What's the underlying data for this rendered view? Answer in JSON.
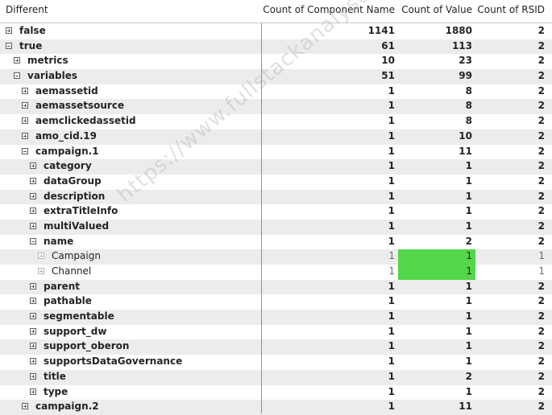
{
  "headers": {
    "label": "Different",
    "col1": "Count of Component Name",
    "col2": "Count of Value",
    "col3": "Count of RSID"
  },
  "watermark": "https://www.fullstackanalyst.io",
  "colors": {
    "highlight": "#54d64a",
    "separator": "#5b9bd5",
    "band": "#ececec"
  },
  "rows": [
    {
      "label": "false",
      "level": 0,
      "toggle": "plus",
      "c1": "1141",
      "c2": "1880",
      "c3": "2"
    },
    {
      "label": "true",
      "level": 0,
      "toggle": "minus",
      "c1": "61",
      "c2": "113",
      "c3": "2"
    },
    {
      "label": "metrics",
      "level": 1,
      "toggle": "plus",
      "c1": "10",
      "c2": "23",
      "c3": "2"
    },
    {
      "label": "variables",
      "level": 1,
      "toggle": "minus",
      "c1": "51",
      "c2": "99",
      "c3": "2"
    },
    {
      "label": "aemassetid",
      "level": 2,
      "toggle": "plus",
      "c1": "1",
      "c2": "8",
      "c3": "2"
    },
    {
      "label": "aemassetsource",
      "level": 2,
      "toggle": "plus",
      "c1": "1",
      "c2": "8",
      "c3": "2"
    },
    {
      "label": "aemclickedassetid",
      "level": 2,
      "toggle": "plus",
      "c1": "1",
      "c2": "8",
      "c3": "2"
    },
    {
      "label": "amo_cid.19",
      "level": 2,
      "toggle": "plus",
      "c1": "1",
      "c2": "10",
      "c3": "2"
    },
    {
      "label": "campaign.1",
      "level": 2,
      "toggle": "minus",
      "c1": "1",
      "c2": "11",
      "c3": "2"
    },
    {
      "label": "category",
      "level": 3,
      "toggle": "plus",
      "c1": "1",
      "c2": "1",
      "c3": "2"
    },
    {
      "label": "dataGroup",
      "level": 3,
      "toggle": "plus",
      "c1": "1",
      "c2": "1",
      "c3": "2"
    },
    {
      "label": "description",
      "level": 3,
      "toggle": "plus",
      "c1": "1",
      "c2": "1",
      "c3": "2"
    },
    {
      "label": "extraTitleInfo",
      "level": 3,
      "toggle": "plus",
      "c1": "1",
      "c2": "1",
      "c3": "2"
    },
    {
      "label": "multiValued",
      "level": 3,
      "toggle": "plus",
      "c1": "1",
      "c2": "1",
      "c3": "2"
    },
    {
      "label": "name",
      "level": 3,
      "toggle": "minus",
      "c1": "1",
      "c2": "2",
      "c3": "2"
    },
    {
      "label": "Campaign",
      "level": 4,
      "toggle": "plus",
      "leaf": true,
      "highlight": true,
      "c1": "1",
      "c2": "1",
      "c3": "1"
    },
    {
      "label": "Channel",
      "level": 4,
      "toggle": "plus",
      "leaf": true,
      "highlight": true,
      "c1": "1",
      "c2": "1",
      "c3": "1"
    },
    {
      "label": "parent",
      "level": 3,
      "toggle": "plus",
      "c1": "1",
      "c2": "1",
      "c3": "2"
    },
    {
      "label": "pathable",
      "level": 3,
      "toggle": "plus",
      "c1": "1",
      "c2": "1",
      "c3": "2"
    },
    {
      "label": "segmentable",
      "level": 3,
      "toggle": "plus",
      "c1": "1",
      "c2": "1",
      "c3": "2"
    },
    {
      "label": "support_dw",
      "level": 3,
      "toggle": "plus",
      "c1": "1",
      "c2": "1",
      "c3": "2"
    },
    {
      "label": "support_oberon",
      "level": 3,
      "toggle": "plus",
      "c1": "1",
      "c2": "1",
      "c3": "2"
    },
    {
      "label": "supportsDataGovernance",
      "level": 3,
      "toggle": "plus",
      "c1": "1",
      "c2": "1",
      "c3": "2"
    },
    {
      "label": "title",
      "level": 3,
      "toggle": "plus",
      "c1": "1",
      "c2": "2",
      "c3": "2"
    },
    {
      "label": "type",
      "level": 3,
      "toggle": "plus",
      "c1": "1",
      "c2": "1",
      "c3": "2"
    },
    {
      "label": "campaign.2",
      "level": 2,
      "toggle": "plus",
      "c1": "1",
      "c2": "11",
      "c3": "2"
    }
  ]
}
